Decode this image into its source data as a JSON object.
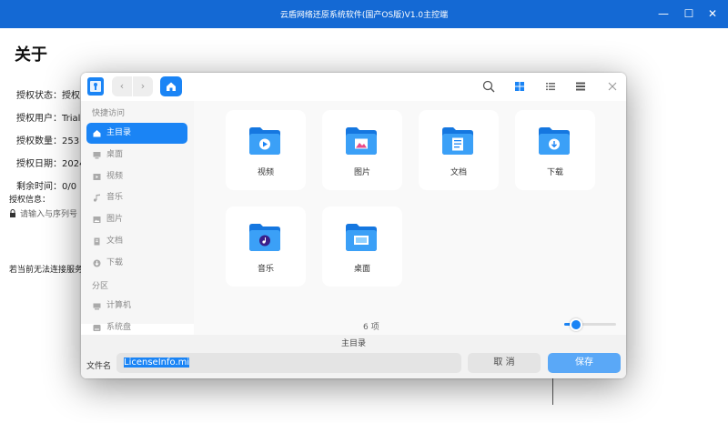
{
  "window": {
    "title": "云盾网络还原系统软件(国产OS版)V1.0主控端",
    "minimize": "—",
    "maximize": "☐",
    "close": "✕"
  },
  "about": {
    "title": "关于",
    "rows": [
      {
        "label": "授权状态：授权"
      },
      {
        "label": "授权用户：Trial"
      },
      {
        "label": "授权数量：253"
      },
      {
        "label": "授权日期：2024"
      },
      {
        "label": "剩余时间：0/0"
      }
    ],
    "license_label": "授权信息：",
    "license_placeholder": "请输入与序列号",
    "server_note": "若当前无法连接服务"
  },
  "dialog": {
    "nav_back": "‹",
    "nav_forward": "›",
    "sidebar": {
      "quick_access": "快捷访问",
      "items": [
        {
          "label": "主目录",
          "icon": "home-icon",
          "active": true
        },
        {
          "label": "桌面",
          "icon": "desktop-icon"
        },
        {
          "label": "视频",
          "icon": "video-icon"
        },
        {
          "label": "音乐",
          "icon": "music-icon"
        },
        {
          "label": "图片",
          "icon": "picture-icon"
        },
        {
          "label": "文档",
          "icon": "document-icon"
        },
        {
          "label": "下载",
          "icon": "download-icon"
        }
      ],
      "partitions": "分区",
      "partition_items": [
        {
          "label": "计算机",
          "icon": "computer-icon"
        },
        {
          "label": "系统盘",
          "icon": "disk-icon"
        }
      ]
    },
    "folders": [
      {
        "label": "视频",
        "icon": "video-folder-icon"
      },
      {
        "label": "图片",
        "icon": "picture-folder-icon"
      },
      {
        "label": "文档",
        "icon": "document-folder-icon"
      },
      {
        "label": "下载",
        "icon": "download-folder-icon"
      },
      {
        "label": "音乐",
        "icon": "music-folder-icon"
      },
      {
        "label": "桌面",
        "icon": "desktop-folder-icon"
      }
    ],
    "item_count": "6 项",
    "zoom_level": 0.3,
    "current_dir": "主目录",
    "filename_label": "文件名",
    "filename_value": "LicenseInfo.mi",
    "cancel": "取 消",
    "save": "保存",
    "colors": {
      "accent": "#1a84f5",
      "titlebar": "#1469d4"
    }
  }
}
